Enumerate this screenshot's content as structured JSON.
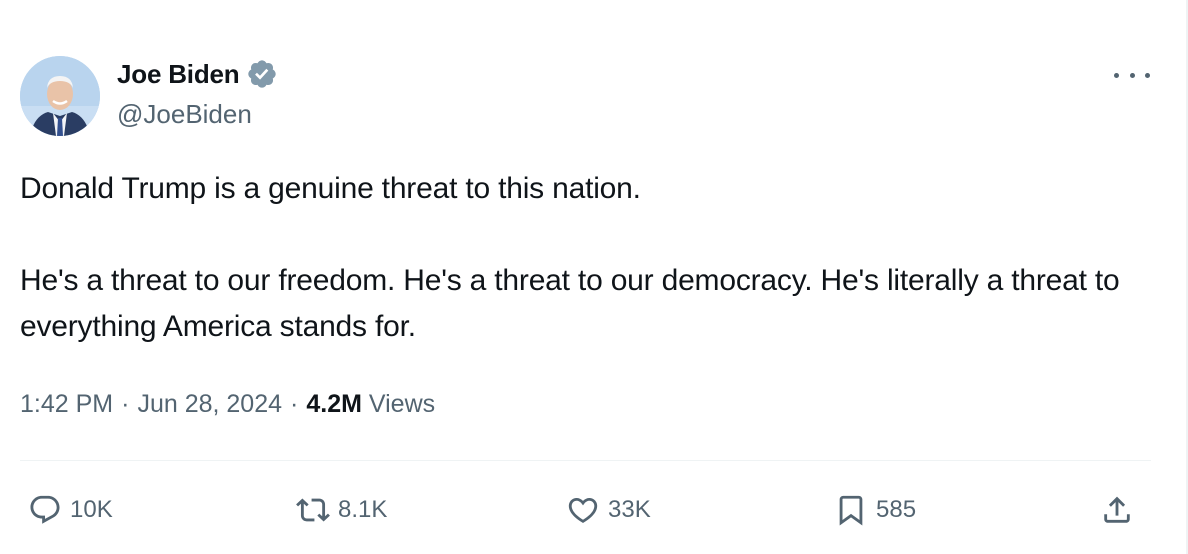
{
  "author": {
    "name": "Joe Biden",
    "handle": "@JoeBiden",
    "verified_icon": "verified-badge-icon",
    "avatar": "profile-photo"
  },
  "more_icon": "more-options-icon",
  "tweet": {
    "paragraphs": [
      "Donald Trump is a genuine threat to this nation.",
      "He's a threat to our freedom. He's a threat to our democracy. He's literally a threat to everything America stands for."
    ]
  },
  "meta": {
    "time": "1:42 PM",
    "separator": "·",
    "date": "Jun 28, 2024",
    "views_count": "4.2M",
    "views_label": "Views"
  },
  "actions": {
    "reply": {
      "icon": "reply-icon",
      "count": "10K"
    },
    "retweet": {
      "icon": "retweet-icon",
      "count": "8.1K"
    },
    "like": {
      "icon": "heart-icon",
      "count": "33K"
    },
    "bookmark": {
      "icon": "bookmark-icon",
      "count": "585"
    },
    "share": {
      "icon": "share-icon"
    }
  },
  "colors": {
    "text_primary": "#0f1419",
    "text_secondary": "#536471",
    "verified_badge": "#829aab",
    "divider": "#eff3f4"
  }
}
